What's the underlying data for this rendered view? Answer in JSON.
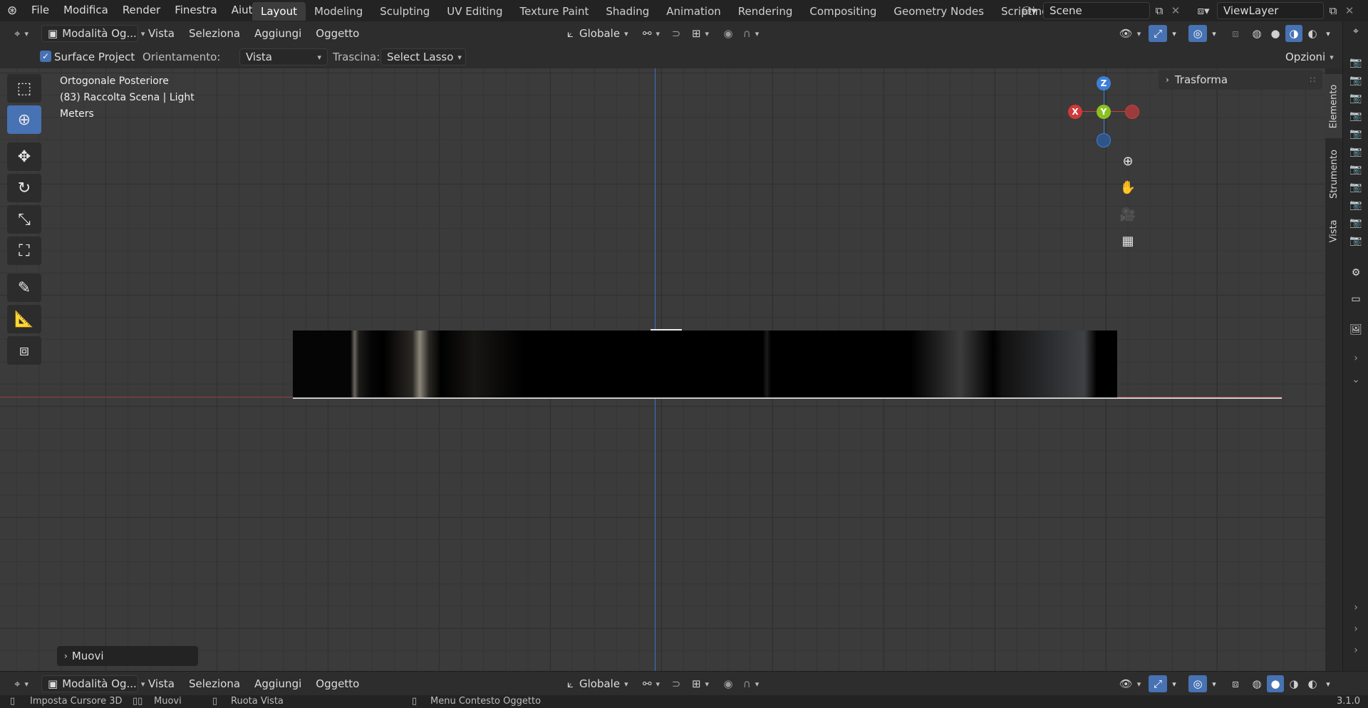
{
  "topbar": {
    "menus": [
      "File",
      "Modifica",
      "Render",
      "Finestra",
      "Aiuto"
    ],
    "workspaces": [
      "Layout",
      "Modeling",
      "Sculpting",
      "UV Editing",
      "Texture Paint",
      "Shading",
      "Animation",
      "Rendering",
      "Compositing",
      "Geometry Nodes",
      "Scripting"
    ],
    "active_workspace": "Layout",
    "add_tab": "+",
    "scene": "Scene",
    "view_layer": "ViewLayer"
  },
  "header": {
    "mode": "Modalità Og...",
    "menus": [
      "Vista",
      "Seleziona",
      "Aggiungi",
      "Oggetto"
    ],
    "orientation": "Globale"
  },
  "toolset": {
    "surface_project_label": "Surface Project",
    "surface_project_checked": true,
    "orientation_label": "Orientamento:",
    "orientation_value": "Vista",
    "drag_label": "Trascina:",
    "drag_value": "Select Lasso",
    "options": "Opzioni"
  },
  "viewport": {
    "view_name": "Ortogonale Posteriore",
    "collection": "(83) Raccolta Scena | Light",
    "units": "Meters",
    "gizmo": {
      "x": "X",
      "y": "Y",
      "z": "Z"
    },
    "transform_panel": "Trasforma",
    "last_op": "Muovi"
  },
  "sidetabs": [
    "Elemento",
    "Strumento",
    "Vista"
  ],
  "header2": {
    "mode": "Modalità Og...",
    "menus": [
      "Vista",
      "Seleziona",
      "Aggiungi",
      "Oggetto"
    ],
    "orientation": "Globale"
  },
  "statusbar": {
    "left_click": "Imposta Cursore 3D",
    "middle_click": "Muovi",
    "mouse_move": "Ruota Vista",
    "right_click": "Menu Contesto Oggetto",
    "version": "3.1.0"
  },
  "colors": {
    "accent": "#4772b3",
    "x_axis": "#d03a3a",
    "y_axis": "#8bc021",
    "z_axis": "#3d7fd6"
  }
}
